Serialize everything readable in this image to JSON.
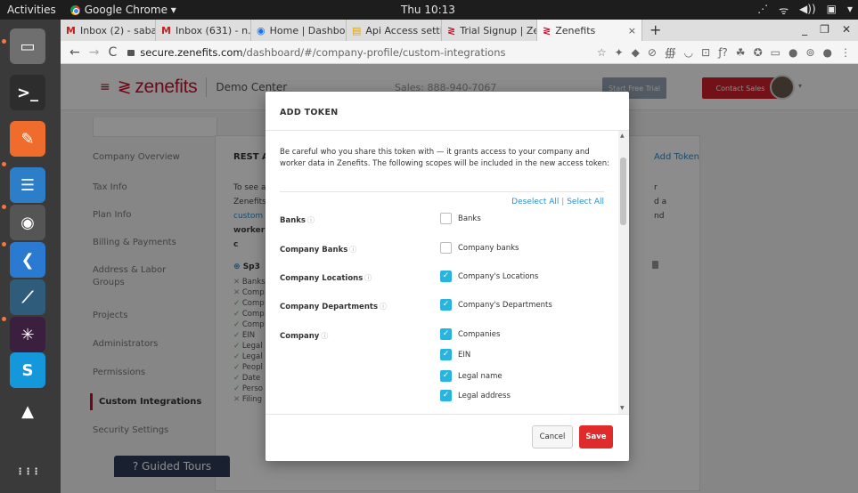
{
  "os": {
    "activities": "Activities",
    "app_name": "Google Chrome ▾",
    "clock": "Thu 10:13",
    "tray": [
      "⋰",
      "ᯤ",
      "◀))",
      "▣",
      "▾"
    ]
  },
  "dock": {
    "items": [
      {
        "name": "files",
        "glyph": "▭",
        "bg": "#6f6f6f"
      },
      {
        "name": "terminal",
        "glyph": ">_",
        "bg": "#2d2d2d"
      },
      {
        "name": "postman",
        "glyph": "✎",
        "bg": "#ef6c2c"
      },
      {
        "name": "text-editor",
        "glyph": "☰",
        "bg": "#2c7ec9"
      },
      {
        "name": "chrome",
        "glyph": "◉",
        "bg": "#555"
      },
      {
        "name": "vscode",
        "glyph": "❮",
        "bg": "#2b7ad1"
      },
      {
        "name": "mysql-workbench",
        "glyph": "⟋",
        "bg": "#2e5c7a"
      },
      {
        "name": "slack",
        "glyph": "✳",
        "bg": "#3b1f3e"
      },
      {
        "name": "skype",
        "glyph": "S",
        "bg": "#1597dc"
      },
      {
        "name": "vlc",
        "glyph": "▲",
        "bg": "#3a3a3a"
      },
      {
        "name": "app-grid",
        "glyph": "⋮⋮⋮",
        "bg": "#3a3a3a"
      }
    ]
  },
  "browser": {
    "tabs": [
      {
        "icon": "M",
        "color": "#c5221f",
        "label": "Inbox (2) - sabari"
      },
      {
        "icon": "M",
        "color": "#c5221f",
        "label": "Inbox (631) - n.sal"
      },
      {
        "icon": "◉",
        "color": "#1a73e8",
        "label": "Home | Dashboar"
      },
      {
        "icon": "▤",
        "color": "#e8a300",
        "label": "Api Access settin"
      },
      {
        "icon": "≷",
        "color": "#c8102e",
        "label": "Trial Signup | Zen"
      },
      {
        "icon": "≷",
        "color": "#c8102e",
        "label": "Zenefits"
      }
    ],
    "new_tab": "+",
    "window_controls": [
      "_",
      "❐",
      "✕"
    ],
    "nav": [
      "←",
      "→",
      "C"
    ],
    "url_host": "secure.zenefits.com",
    "url_path": "/dashboard/#/company-profile/custom-integrations",
    "extensions": [
      "☆",
      "✦",
      "◆",
      "⊘",
      "∰",
      "◡",
      "⊡",
      "ƒ?",
      "☘",
      "✪",
      "▭",
      "●",
      "⊚",
      "●",
      "⋮"
    ]
  },
  "app": {
    "hamburger": "≡",
    "logo_mark": "≷",
    "logo_text": "zenefits",
    "demo_center": "Demo Center",
    "header_center": "Sales: 888-940-7067",
    "trial_button": "Start Free Trial",
    "sales_button": "Contact Sales",
    "sidebar": [
      {
        "label": "Company Overview",
        "state": "normal"
      },
      {
        "label": "Tax Info",
        "state": "normal"
      },
      {
        "label": "Plan Info",
        "state": "normal"
      },
      {
        "label": "Billing & Payments",
        "state": "normal"
      },
      {
        "label": "Address & Labor",
        "state": "normal"
      },
      {
        "label": "Groups",
        "state": "normal"
      },
      {
        "label": "Projects",
        "state": "normal"
      },
      {
        "label": "Administrators",
        "state": "normal"
      },
      {
        "label": "Permissions",
        "state": "normal"
      },
      {
        "label": "Custom Integrations",
        "state": "active"
      },
      {
        "label": "Security Settings",
        "state": "normal"
      }
    ],
    "card_title": "REST A",
    "add_token_link": "Add Token",
    "card_text": [
      "To see a",
      "Zenefits",
      "custom i",
      "worker c"
    ],
    "card_right": [
      "r",
      "d a",
      "nd"
    ],
    "bg_token_name": "Sp3",
    "bg_scopes": [
      {
        "mark": "✕",
        "text": "Banks",
        "color": "#999"
      },
      {
        "mark": "✕",
        "text": "Comp",
        "color": "#999"
      },
      {
        "mark": "✓",
        "text": "Comp",
        "color": "#4caf50"
      },
      {
        "mark": "✓",
        "text": "Comp",
        "color": "#4caf50"
      },
      {
        "mark": "✓",
        "text": "Comp",
        "color": "#4caf50"
      },
      {
        "mark": "✓",
        "text": "EIN",
        "color": "#4caf50"
      },
      {
        "mark": "✓",
        "text": "Legal",
        "color": "#4caf50"
      },
      {
        "mark": "✓",
        "text": "Legal",
        "color": "#4caf50"
      },
      {
        "mark": "✓",
        "text": "Peopl",
        "color": "#4caf50"
      },
      {
        "mark": "✓",
        "text": "Date",
        "color": "#4caf50"
      },
      {
        "mark": "✓",
        "text": "Perso",
        "color": "#4caf50"
      },
      {
        "mark": "✕",
        "text": "Filing",
        "color": "#999"
      }
    ],
    "guided_tours": "? Guided Tours"
  },
  "modal": {
    "title": "ADD TOKEN",
    "description": "Be careful who you share this token with — it grants access to your company and worker data in Zenefits. The following scopes will be included in the new access token:",
    "deselect_all": "Deselect All",
    "separator": "|",
    "select_all": "Select All",
    "help_glyph": "ⓘ",
    "scopes": [
      {
        "group": "Banks",
        "options": [
          {
            "label": "Banks",
            "checked": false
          }
        ]
      },
      {
        "group": "Company Banks",
        "options": [
          {
            "label": "Company banks",
            "checked": false
          }
        ]
      },
      {
        "group": "Company Locations",
        "options": [
          {
            "label": "Company's Locations",
            "checked": true
          }
        ]
      },
      {
        "group": "Company Departments",
        "options": [
          {
            "label": "Company's Departments",
            "checked": true
          }
        ]
      },
      {
        "group": "Company",
        "options": [
          {
            "label": "Companies",
            "checked": true
          },
          {
            "label": "EIN",
            "checked": true
          },
          {
            "label": "Legal name",
            "checked": true
          },
          {
            "label": "Legal address",
            "checked": true
          }
        ]
      }
    ],
    "cancel": "Cancel",
    "save": "Save"
  },
  "colors": {
    "brand_red": "#c8102e",
    "link_blue": "#2e8fc8",
    "checkbox_blue": "#28b4e0",
    "save_red": "#e02b2b"
  }
}
